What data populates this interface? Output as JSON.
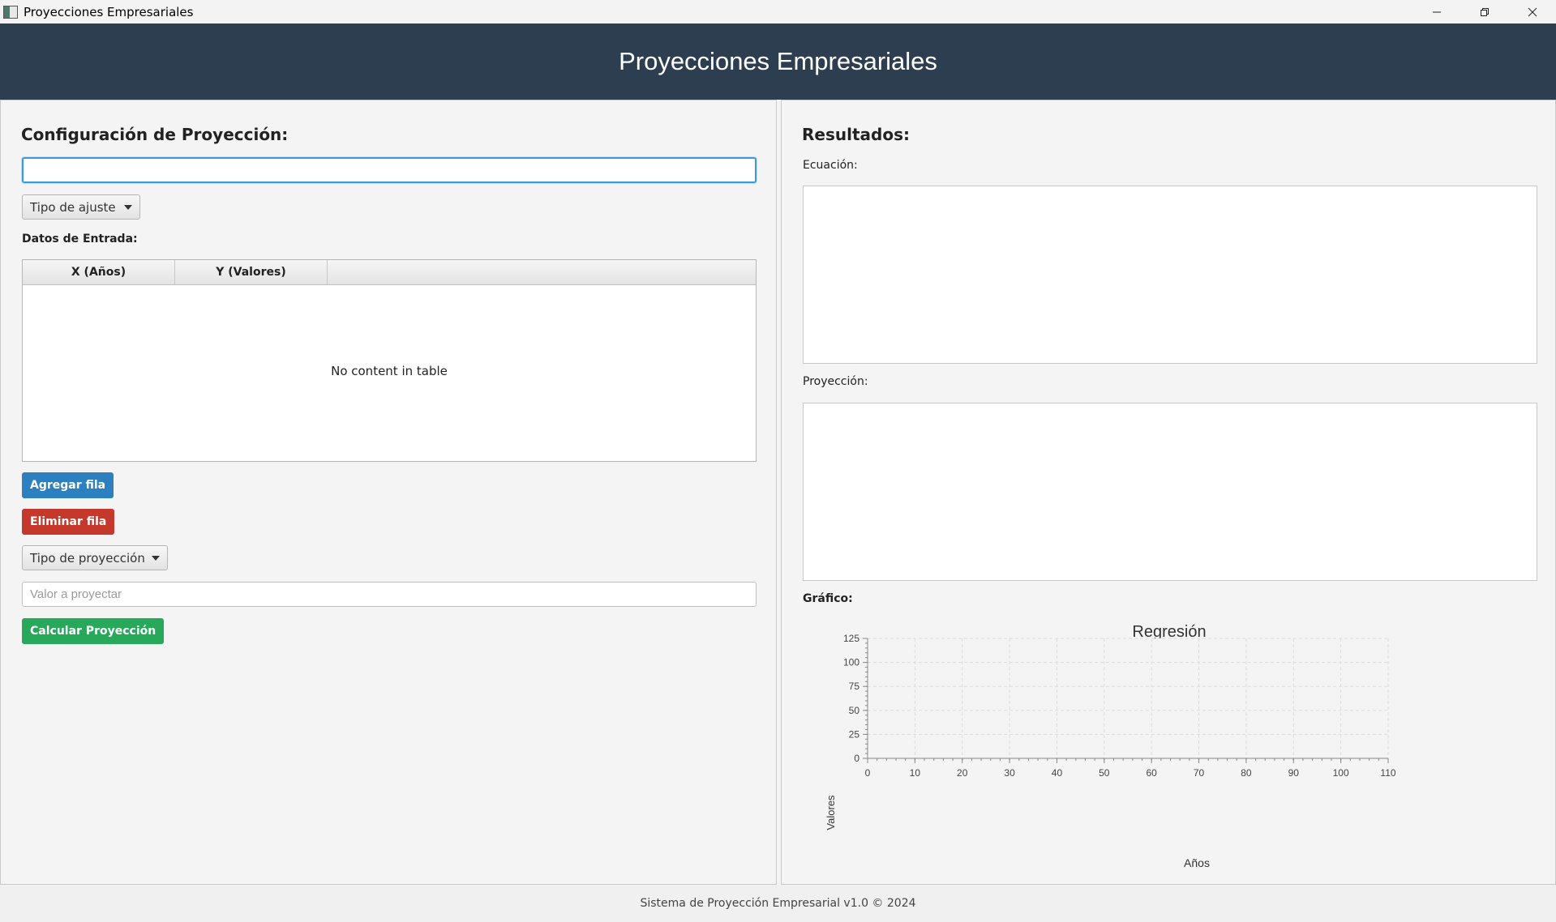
{
  "window": {
    "title": "Proyecciones Empresariales",
    "controls": [
      "minimize-icon",
      "restore-icon",
      "close-icon"
    ]
  },
  "header": {
    "title": "Proyecciones Empresariales",
    "background": "#2c3e50"
  },
  "left": {
    "title": "Configuración de Proyección:",
    "name_input_value": "",
    "fit_combo": "Tipo de ajuste",
    "data_label": "Datos de Entrada:",
    "table": {
      "columns": [
        "X (Años)",
        "Y (Valores)"
      ],
      "empty_text": "No content in table"
    },
    "add_row": "Agregar fila",
    "delete_row": "Eliminar fila",
    "projection_combo": "Tipo de proyección",
    "value_placeholder": "Valor a proyectar",
    "calculate": "Calcular Proyección",
    "colors": {
      "add": "#2c80c0",
      "delete": "#c5382c",
      "calculate": "#28a85a"
    }
  },
  "right": {
    "title": "Resultados:",
    "equation_label": "Ecuación:",
    "equation_value": "",
    "projection_label": "Proyección:",
    "projection_value": "",
    "chart_label": "Gráfico:"
  },
  "chart_data": {
    "type": "scatter",
    "title": "Regresión",
    "xlabel": "Años",
    "ylabel": "Valores",
    "xlim": [
      0,
      110
    ],
    "ylim": [
      0,
      125
    ],
    "x_ticks": [
      0,
      10,
      20,
      30,
      40,
      50,
      60,
      70,
      80,
      90,
      100,
      110
    ],
    "y_ticks": [
      0,
      25,
      50,
      75,
      100,
      125
    ],
    "grid": true,
    "series": []
  },
  "status": "Sistema de Proyección Empresarial v1.0 © 2024"
}
